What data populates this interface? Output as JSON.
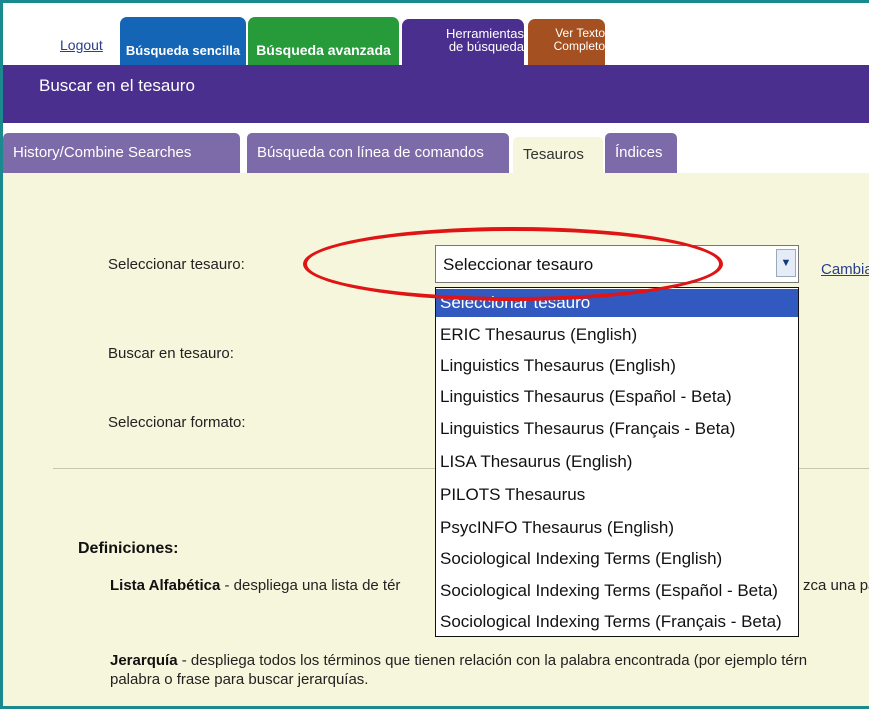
{
  "top_nav": {
    "logout": "Logout",
    "basic_search": "Búsqueda sencilla",
    "advanced_search": "Búsqueda avanzada",
    "tools_line1": "Herramientas",
    "tools_line2": "de búsqueda",
    "fulltext_line1": "Ver Texto",
    "fulltext_line2": "Completo"
  },
  "header": {
    "title": "Buscar en el tesauro"
  },
  "sub_tabs": [
    {
      "label": "History/Combine Searches"
    },
    {
      "label": "Búsqueda con línea de comandos"
    },
    {
      "label": "Tesauros",
      "active": true
    },
    {
      "label": "Índices"
    }
  ],
  "form": {
    "select_thesaurus_label": "Seleccionar tesauro:",
    "select_thesaurus_value": "Seleccionar tesauro",
    "search_thesaurus_label": "Buscar en tesauro:",
    "select_format_label": "Seleccionar formato:",
    "change_link": "Cambiar"
  },
  "dropdown_options": [
    "Seleccionar tesauro",
    "ERIC Thesaurus (English)",
    "Linguistics Thesaurus (English)",
    "Linguistics Thesaurus (Español - Beta)",
    "Linguistics Thesaurus (Français - Beta)",
    "LISA Thesaurus (English)",
    "PILOTS Thesaurus",
    "PsycINFO Thesaurus (English)",
    "Sociological Indexing Terms (English)",
    "Sociological Indexing Terms (Español - Beta)",
    "Sociological Indexing Terms (Français - Beta)"
  ],
  "definitions": {
    "title": "Definiciones:",
    "alpha_term": "Lista Alfabética",
    "alpha_text_a": " - despliega una lista de tér",
    "alpha_text_b": "zca una pal",
    "hier_term": "Jerarquía",
    "hier_text": " - despliega todos los términos que tienen relación con la palabra encontrada (por ejemplo térn",
    "hier_text2": "palabra o frase para buscar jerarquías."
  },
  "colors": {
    "frame": "#1b8a8f",
    "header_purple": "#4b2f8f",
    "tab_basic": "#1565b7",
    "tab_advanced": "#279a3a",
    "tab_fulltext": "#a45020",
    "content_bg": "#f5f6dc",
    "highlight_oval": "#e01414",
    "selected_option": "#3159c0"
  }
}
